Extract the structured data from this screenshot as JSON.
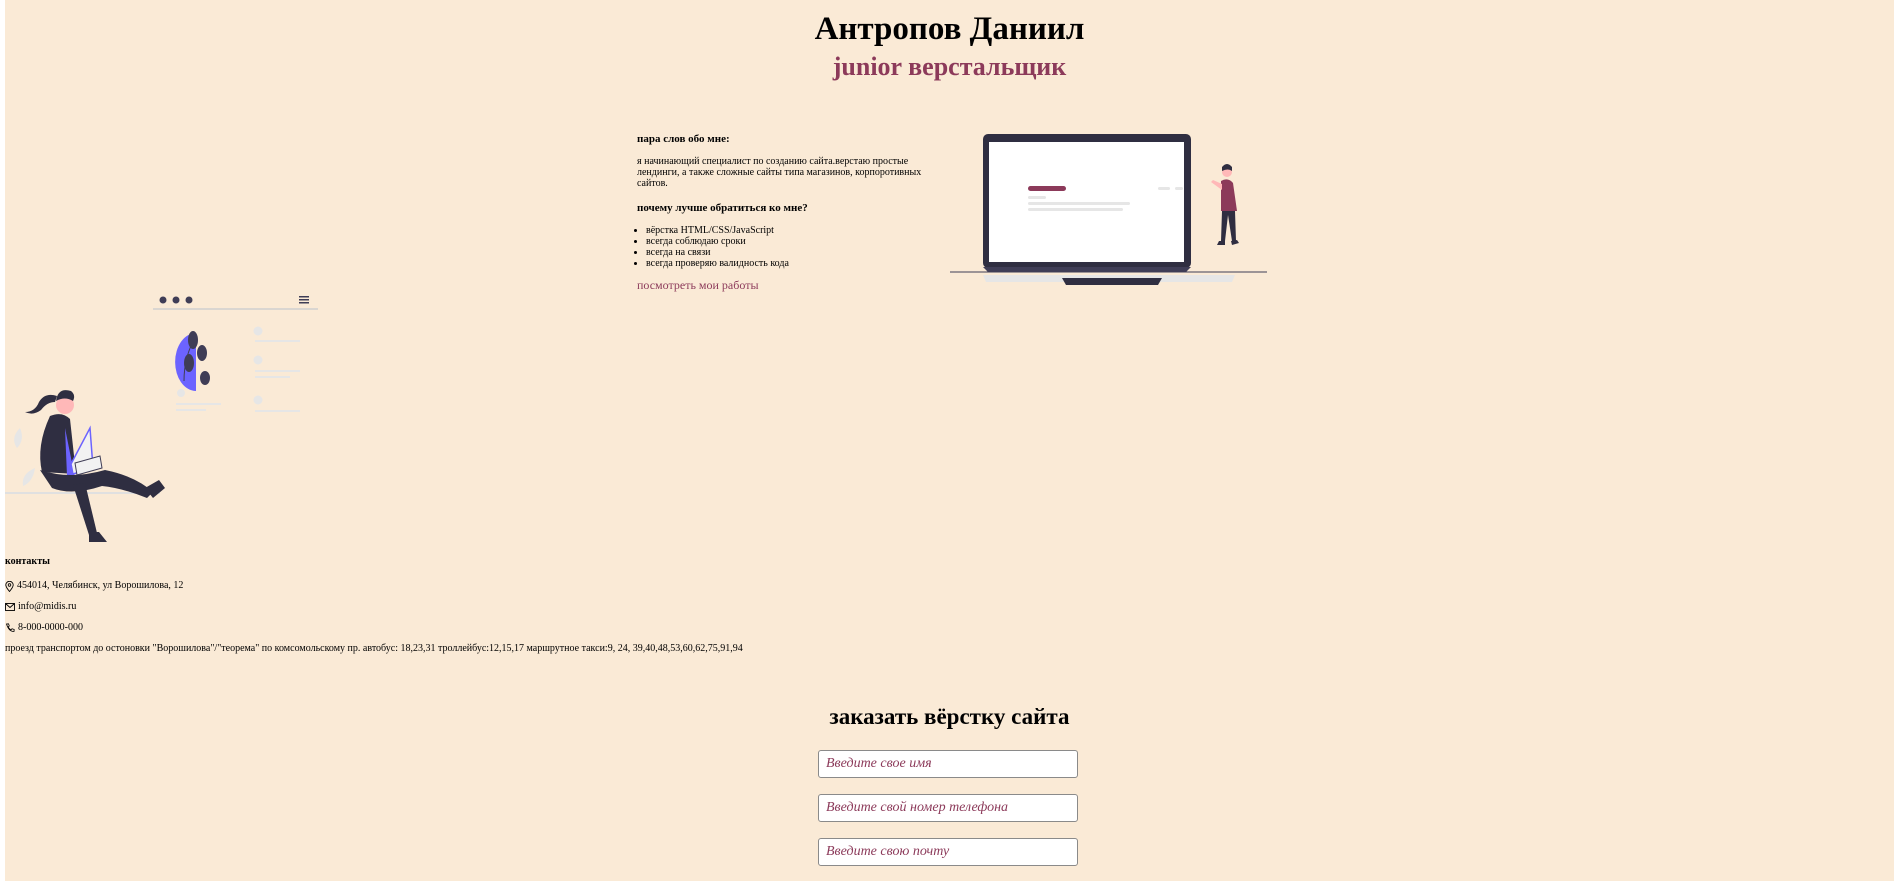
{
  "header": {
    "name": "Антропов Даниил",
    "role": "junior верстальщик"
  },
  "about": {
    "heading": "пара слов обо мне:",
    "text": "я начинающий специалист по созданию сайта.верстаю простые лендинги, а также сложные сайты типа магазинов, корпоротивных сайтов.",
    "why_heading": "почему лучше обратиться ко мне?",
    "reasons": [
      "вёрстка HTML/CSS/JavaScript",
      "всегда соблюдаю сроки",
      "всегда на связи",
      "всегда проверяю валидность кода"
    ],
    "works_link": "посмотреть мои работы"
  },
  "contacts": {
    "title": "контакты",
    "address": "454014, Челябинск, ул Ворошилова, 12",
    "email": "info@midis.ru",
    "phone": "8-000-0000-000",
    "transit": "проезд транспортом до остоновки \"Ворошилова\"/\"теорема\" по комсомольскому пр. автобус: 18,23,31 троллейбус:12,15,17 маршрутное такси:9, 24, 39,40,48,53,60,62,75,91,94"
  },
  "order": {
    "title": "заказать вёрстку сайта",
    "name_placeholder": "Введите свое имя",
    "phone_placeholder": "Введите свой номер телефона",
    "email_placeholder": "Введите свою почту"
  },
  "colors": {
    "background": "#faead6",
    "accent": "#8c3a5a",
    "illustration_dark": "#2f2e41",
    "illustration_purple": "#6c63ff"
  },
  "icons": [
    "location-pin-icon",
    "envelope-icon",
    "phone-icon"
  ]
}
